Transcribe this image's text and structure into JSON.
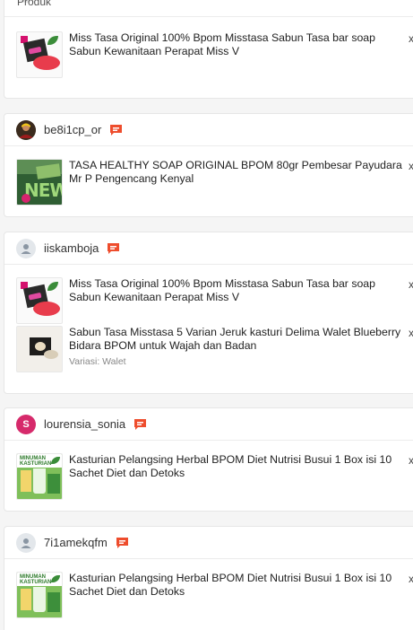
{
  "top_section": {
    "header_label": "Produk",
    "product": {
      "title": "Miss Tasa Original 100% Bpom Misstasa Sabun Tasa bar soap Sabun Kewanitaan Perapat Miss V",
      "qty": "x"
    }
  },
  "orders": [
    {
      "username": "be8i1cp_or",
      "avatar_type": "photo",
      "products": [
        {
          "title": "TASA HEALTHY SOAP ORIGINAL BPOM 80gr Pembesar Payudara Mr P Pengencang Kenyal",
          "variation": "",
          "qty": "x",
          "thumb": "healthy-soap"
        }
      ]
    },
    {
      "username": "iiskamboja",
      "avatar_type": "default",
      "products": [
        {
          "title": "Miss Tasa Original 100% Bpom Misstasa Sabun Tasa bar soap Sabun Kewanitaan Perapat Miss V",
          "variation": "",
          "qty": "x",
          "thumb": "misstasa"
        },
        {
          "title": "Sabun Tasa Misstasa 5 Varian Jeruk kasturi Delima Walet Blueberry Bidara BPOM untuk Wajah dan Badan",
          "variation": "Variasi: Walet",
          "qty": "x",
          "thumb": "walet"
        }
      ]
    },
    {
      "username": "lourensia_sonia",
      "avatar_type": "letter",
      "avatar_letter": "S",
      "products": [
        {
          "title": "Kasturian Pelangsing Herbal BPOM Diet Nutrisi Busui 1 Box isi 10 Sachet Diet dan Detoks",
          "variation": "",
          "qty": "x",
          "thumb": "kasturian"
        }
      ]
    },
    {
      "username": "7i1amekqfm",
      "avatar_type": "default",
      "products": [
        {
          "title": "Kasturian Pelangsing Herbal BPOM Diet Nutrisi Busui 1 Box isi 10 Sachet Diet dan Detoks",
          "variation": "",
          "qty": "x",
          "thumb": "kasturian"
        }
      ]
    }
  ],
  "colors": {
    "chat_icon": "#ee4d2d",
    "letter_avatar": "#d62a6b"
  },
  "icons": {
    "chat": "chat-icon",
    "default_avatar": "user-icon"
  }
}
